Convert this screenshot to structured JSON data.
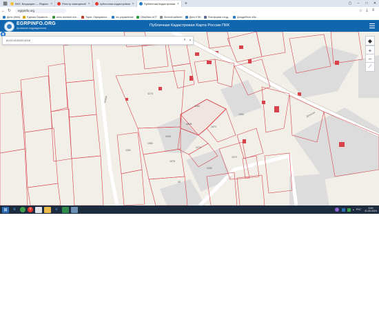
{
  "browser": {
    "tabs": [
      {
        "label": "ВКЗ: Входящие — Яндекс",
        "color": "#f3c241",
        "active": false
      },
      {
        "label": "Реестр извещений",
        "color": "#e33b2e",
        "active": false
      },
      {
        "label": "публичная кадастровая",
        "color": "#e33b2e",
        "active": false
      },
      {
        "label": "Публичная Кадастровая",
        "color": "#2d7dc0",
        "active": true
      }
    ],
    "url": "egrpinfo.org",
    "bookmarks": [
      {
        "label": "Дело (Web)",
        "color": "#2d7dc0"
      },
      {
        "label": "Единая Справочн...",
        "color": "#d0a400"
      },
      {
        "label": "armo.donland.ru/e...",
        "color": "#3f8f3f"
      },
      {
        "label": "Торги: Официальн...",
        "color": "#c0392b"
      },
      {
        "label": "гос.управление",
        "color": "#2d7dc0"
      },
      {
        "label": "Сбербанк АСТ",
        "color": "#2e9b43"
      },
      {
        "label": "Личный кабинет",
        "color": "#888888"
      },
      {
        "label": "Дело ЕЭБ",
        "color": "#2d7dc0"
      },
      {
        "label": "Платформа госуд...",
        "color": "#5a6b8c"
      },
      {
        "label": "Досудебное обж...",
        "color": "#2d7dc0"
      }
    ]
  },
  "site": {
    "logo_title": "EGRPINFO.ORG",
    "logo_subtitle": "Архивные подразделения",
    "title": "Публичная Кадастровая Карта России ПКК"
  },
  "map": {
    "search_value": "61:02:0120102:4218",
    "street_labels": [
      "Донская",
      "Новая"
    ],
    "parcel_labels": [
      "4174",
      "4164",
      "1074",
      "4218",
      "4160",
      "1052",
      "4175",
      "30",
      "1076",
      "4152",
      "1053",
      "1070",
      "1201"
    ],
    "accent_color": "#d9424b"
  },
  "taskbar": {
    "time": "9:49",
    "date": "31.05.2024",
    "lang": "РУС"
  }
}
